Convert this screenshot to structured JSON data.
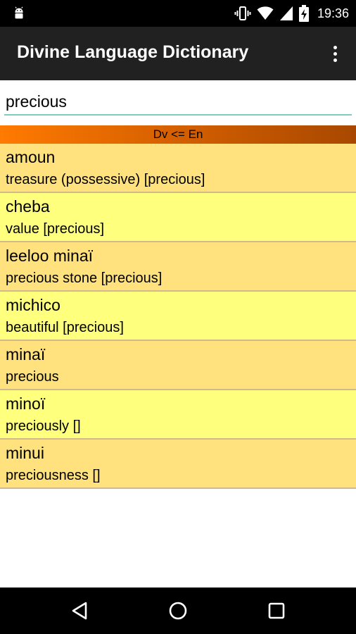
{
  "status_bar": {
    "time": "19:36",
    "icons": [
      "android-icon",
      "vibrate-icon",
      "wifi-icon",
      "signal-icon",
      "battery-charging-icon"
    ]
  },
  "app_bar": {
    "title": "Divine Language Dictionary",
    "menu_icon": "overflow-menu-icon"
  },
  "search": {
    "value": "precious"
  },
  "direction": "Dv <= En",
  "results": [
    {
      "term": "amoun",
      "meaning": "treasure (possessive) [precious]"
    },
    {
      "term": "cheba",
      "meaning": "value [precious]"
    },
    {
      "term": "leeloo minaï",
      "meaning": "precious stone [precious]"
    },
    {
      "term": "michico",
      "meaning": "beautiful [precious]"
    },
    {
      "term": "minaï",
      "meaning": "precious"
    },
    {
      "term": "minoï",
      "meaning": "preciously []"
    },
    {
      "term": "minui",
      "meaning": "preciousness []"
    }
  ],
  "nav_bar": {
    "icons": [
      "back-icon",
      "home-icon",
      "recents-icon"
    ]
  },
  "colors": {
    "row_odd": "#ffe27e",
    "row_even": "#ffff7e",
    "header_start": "#ff7a00",
    "header_end": "#a84800",
    "app_bar": "#212121",
    "input_underline": "#80cbc4"
  }
}
